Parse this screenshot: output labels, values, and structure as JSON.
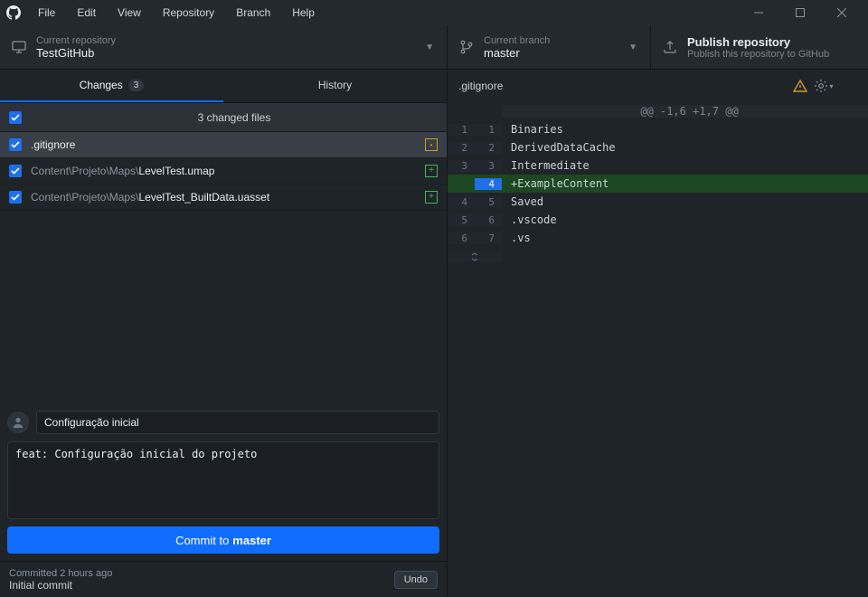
{
  "menu": [
    "File",
    "Edit",
    "View",
    "Repository",
    "Branch",
    "Help"
  ],
  "toolbar": {
    "repo_label": "Current repository",
    "repo_value": "TestGitHub",
    "branch_label": "Current branch",
    "branch_value": "master",
    "publish_title": "Publish repository",
    "publish_sub": "Publish this repository to GitHub"
  },
  "tabs": {
    "changes_label": "Changes",
    "changes_count": "3",
    "history_label": "History"
  },
  "changes": {
    "header": "3 changed files",
    "files": [
      {
        "prefix": "",
        "name": ".gitignore",
        "status": "mod"
      },
      {
        "prefix": "Content\\Projeto\\Maps\\",
        "name": "LevelTest.umap",
        "status": "add"
      },
      {
        "prefix": "Content\\Projeto\\Maps\\",
        "name": "LevelTest_BuiltData.uasset",
        "status": "add"
      }
    ]
  },
  "commit": {
    "summary": "Configuração inicial",
    "description": "feat: Configuração inicial do projeto",
    "button_prefix": "Commit to ",
    "button_branch": "master"
  },
  "last_commit": {
    "time": "Committed 2 hours ago",
    "message": "Initial commit",
    "undo": "Undo"
  },
  "diff": {
    "filename": ".gitignore",
    "hunk": "@@ -1,6 +1,7 @@",
    "lines": [
      {
        "l": "1",
        "r": "1",
        "t": "ctx",
        "c": "Binaries"
      },
      {
        "l": "2",
        "r": "2",
        "t": "ctx",
        "c": "DerivedDataCache"
      },
      {
        "l": "3",
        "r": "3",
        "t": "ctx",
        "c": "Intermediate"
      },
      {
        "l": "",
        "r": "4",
        "t": "add",
        "c": "+ExampleContent"
      },
      {
        "l": "4",
        "r": "5",
        "t": "ctx",
        "c": "Saved"
      },
      {
        "l": "5",
        "r": "6",
        "t": "ctx",
        "c": ".vscode"
      },
      {
        "l": "6",
        "r": "7",
        "t": "ctx",
        "c": ".vs"
      }
    ]
  }
}
